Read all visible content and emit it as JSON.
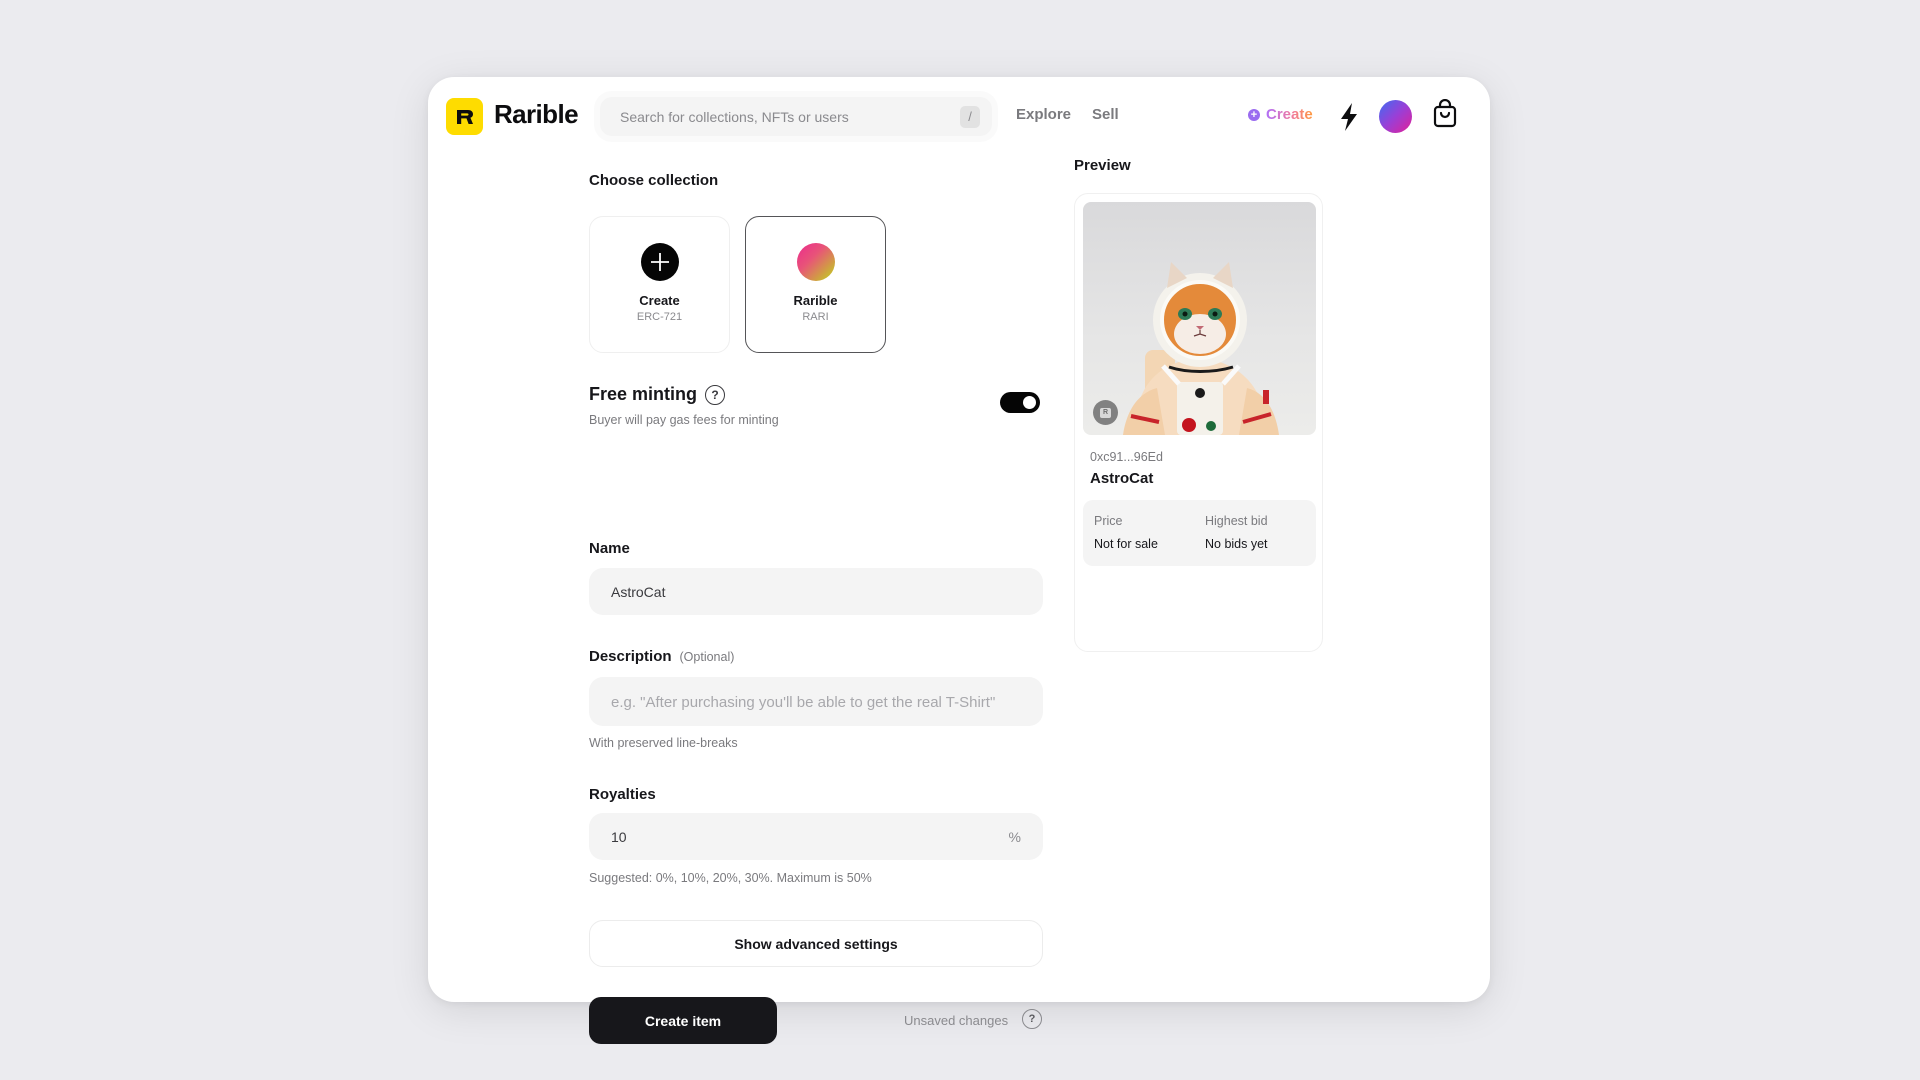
{
  "header": {
    "brand": "Rarible",
    "search": {
      "placeholder": "Search for collections, NFTs or users",
      "shortcut": "/"
    },
    "nav": [
      {
        "label": "Explore"
      },
      {
        "label": "Sell"
      }
    ],
    "create_label": "Create",
    "icons": [
      "rarible-logo-icon",
      "bolt-icon",
      "avatar",
      "shopping-bag-icon"
    ]
  },
  "form": {
    "choose_collection": {
      "title": "Choose collection",
      "options": [
        {
          "name": "Create",
          "sub": "ERC-721",
          "icon": "plus-icon",
          "selected": false
        },
        {
          "name": "Rarible",
          "sub": "RARI",
          "icon": "collection-gradient-icon",
          "selected": true
        }
      ]
    },
    "free_minting": {
      "title": "Free minting",
      "help": "?",
      "subtitle": "Buyer will pay gas fees for minting",
      "enabled": true
    },
    "name": {
      "label": "Name",
      "value": "AstroCat"
    },
    "description": {
      "label": "Description",
      "optional": "(Optional)",
      "value": "",
      "placeholder": "e.g. \"After purchasing you'll be able to get the real T-Shirt\"",
      "helper": "With preserved line-breaks"
    },
    "royalties": {
      "label": "Royalties",
      "value": "10",
      "suffix": "%",
      "helper": "Suggested: 0%, 10%, 20%, 30%. Maximum is 50%"
    },
    "advanced_label": "Show advanced settings",
    "submit_label": "Create item",
    "status": "Unsaved changes",
    "status_help": "?"
  },
  "preview": {
    "title": "Preview",
    "image_alt": "AstroCat - cat figurine in astronaut suit",
    "owner": "0xc91...96Ed",
    "name": "AstroCat",
    "price_label": "Price",
    "price_value": "Not for sale",
    "bid_label": "Highest bid",
    "bid_value": "No bids yet"
  },
  "colors": {
    "brand_yellow": "#fedc00",
    "primary_button": "#17171b",
    "background": "#ebebef"
  }
}
